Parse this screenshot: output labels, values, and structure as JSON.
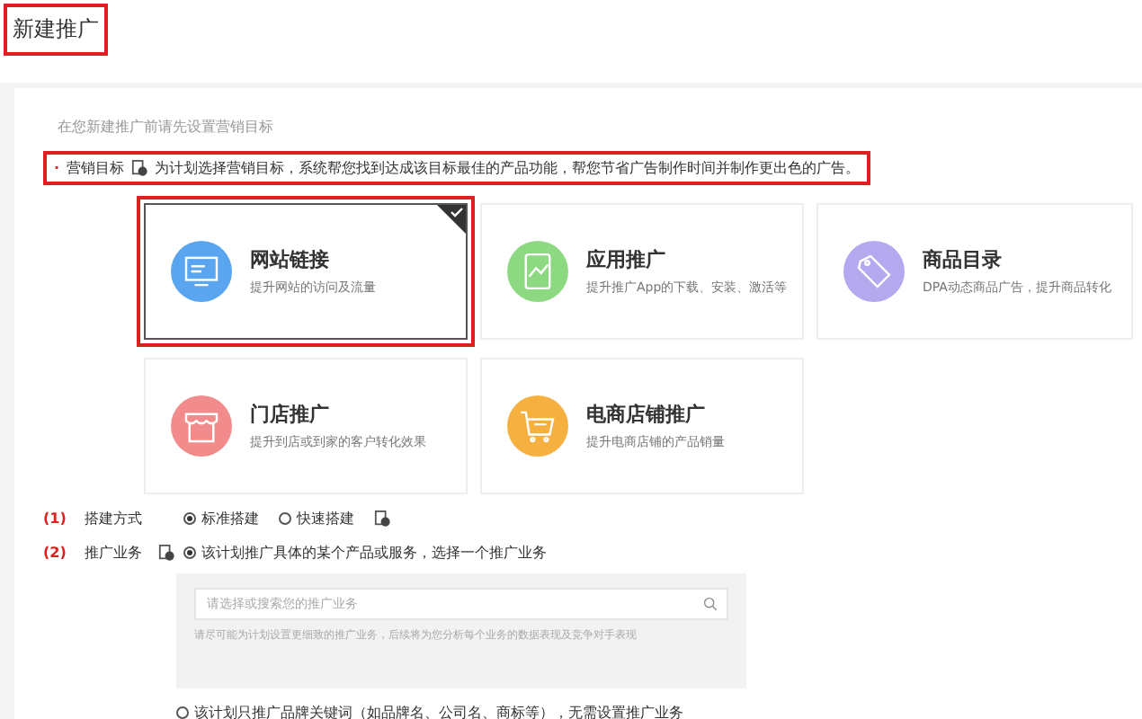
{
  "page_title": {
    "text": "新建推广",
    "highlighted": true
  },
  "intro": "在您新建推广前请先设置营销目标",
  "goal_notice": {
    "bullet": "·",
    "label": "营销目标",
    "text": "为计划选择营销目标，系统帮您找到达成该目标最佳的产品功能，帮您节省广告制作时间并制作更出色的广告。",
    "highlighted": true
  },
  "goals": [
    {
      "kind": "monitor",
      "title": "网站链接",
      "desc": "提升网站的访问及流量",
      "color": "#5aa5ef",
      "selected": true,
      "highlighted": true
    },
    {
      "kind": "phone",
      "title": "应用推广",
      "desc": "提升推广App的下载、安装、激活等",
      "color": "#8cd982",
      "selected": false,
      "highlighted": false
    },
    {
      "kind": "tag",
      "title": "商品目录",
      "desc": "DPA动态商品广告，提升商品转化",
      "color": "#b4a8ef",
      "selected": false,
      "highlighted": false
    },
    {
      "kind": "store",
      "title": "门店推广",
      "desc": "提升到店或到家的客户转化效果",
      "color": "#f28b8b",
      "selected": false,
      "highlighted": false
    },
    {
      "kind": "cart",
      "title": "电商店铺推广",
      "desc": "提升电商店铺的产品销量",
      "color": "#f6b040",
      "selected": false,
      "highlighted": false
    }
  ],
  "build_mode": {
    "step": "(1)",
    "label": "搭建方式",
    "options": [
      {
        "label": "标准搭建",
        "selected": true
      },
      {
        "label": "快速搭建",
        "selected": false
      }
    ]
  },
  "business": {
    "step": "(2)",
    "label": "推广业务",
    "options": [
      {
        "label": "该计划推广具体的某个产品或服务，选择一个推广业务",
        "selected": true
      },
      {
        "label": "该计划只推广品牌关键词（如品牌名、公司名、商标等），无需设置推广业务",
        "selected": false
      }
    ],
    "search": {
      "placeholder": "请选择或搜索您的推广业务"
    },
    "hint": "请尽可能为计划设置更细致的推广业务，后续将为您分析每个业务的数据表现及竞争对手表现"
  }
}
